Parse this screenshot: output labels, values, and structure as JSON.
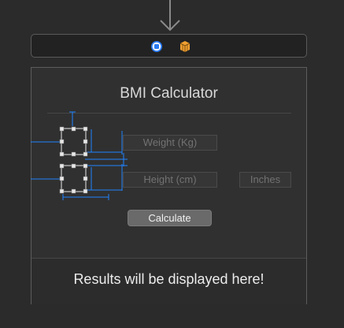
{
  "scene_dock": {
    "icons": [
      "view-controller-icon",
      "first-responder-icon"
    ]
  },
  "view": {
    "title": "BMI Calculator",
    "weight_placeholder": "Weight (Kg)",
    "height_placeholder": "Height (cm)",
    "inches_placeholder": "Inches",
    "calculate_label": "Calculate",
    "results_text": "Results will be displayed here!"
  },
  "colors": {
    "canvas": "#2b2b2b",
    "panel": "#303030",
    "constraint": "#1f83ff",
    "dock_blue": "#2a7cf5",
    "dock_orange": "#f0a030"
  }
}
